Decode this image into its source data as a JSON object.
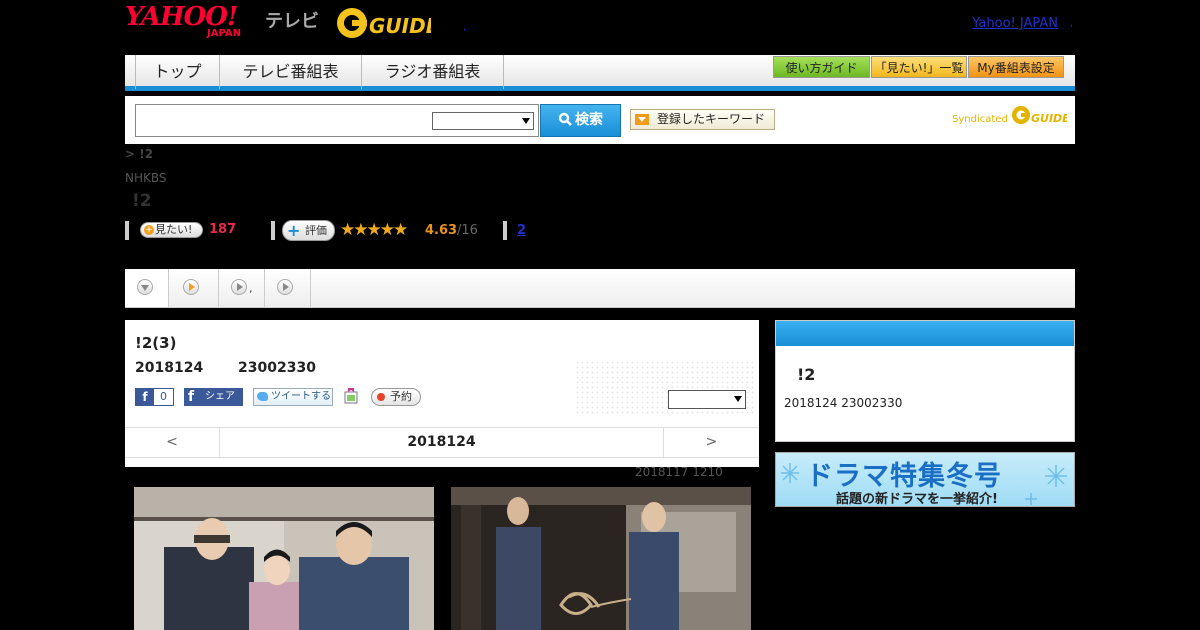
{
  "header": {
    "yahoo_logo": "YAHOO!",
    "japan_logo": "JAPAN",
    "tv_label": "テレビ",
    "gguide_logo": "G-GUIDE",
    "dot": ",",
    "yahoo_japan_link": "Yahoo! JAPAN",
    "dot2": ","
  },
  "nav": {
    "tabs": [
      "トップ",
      "テレビ番組表",
      "ラジオ番組表"
    ],
    "buttons": [
      "使い方ガイド",
      "「見たい!」一覧",
      "My番組表設定"
    ],
    "button_colors": [
      "#7bc32a",
      "#f6c62a",
      "#f5a623"
    ]
  },
  "search": {
    "input_value": "",
    "select_value": "",
    "button_label": "検索",
    "keyword_button": "登録したキーワード",
    "syndicated": "Syndicated"
  },
  "breadcrumb": ">  !2",
  "channel": "NHKBS",
  "program": {
    "title": "!2",
    "mitai_label": "見たい!",
    "mitai_count": "187",
    "hyoka_label": "評価",
    "stars_display": "★★★★★",
    "rating": "4.63",
    "rating_count": "/16",
    "review_count": "2"
  },
  "subtabs": {
    "tab2_text": ","
  },
  "episode": {
    "title": "!2(3)",
    "date": "2018124",
    "time": "23002330",
    "fb_like_count": "0",
    "fb_share": "シェア",
    "tweet": "ツイートする",
    "yoyaku": "予約",
    "select_value": "",
    "pager_prev": "<",
    "pager_date": "2018124",
    "pager_next": ">",
    "updated": "2018117  1210"
  },
  "sidebar": {
    "title": "!2",
    "datetime": "2018124  23002330",
    "banner_title": "ドラマ特集冬号",
    "banner_sub": "話題の新ドラマを一挙紹介!"
  }
}
